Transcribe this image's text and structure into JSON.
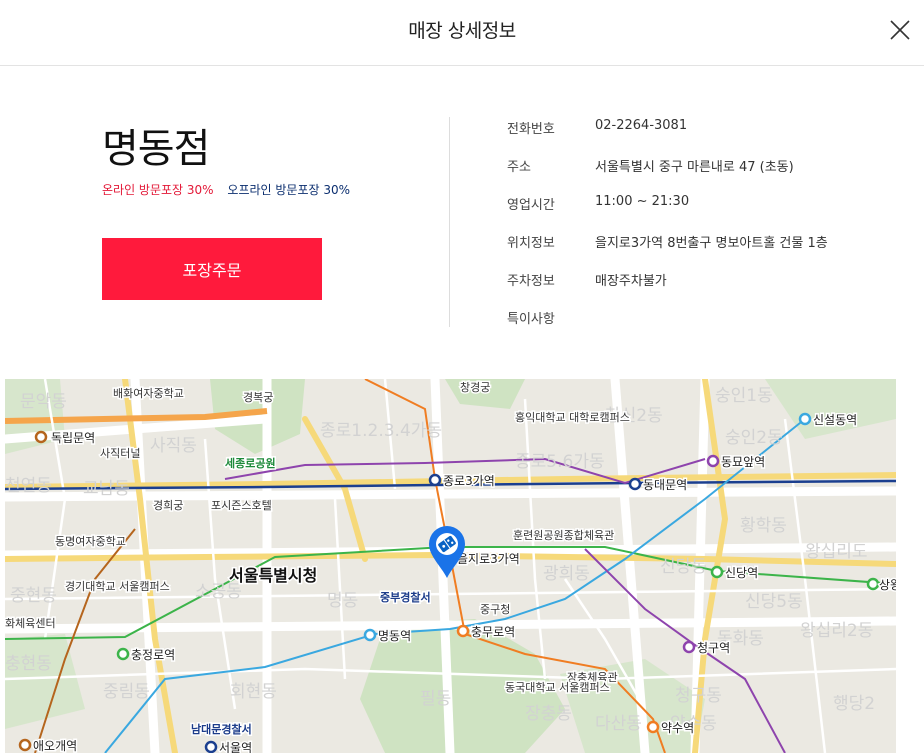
{
  "header": {
    "title": "매장 상세정보"
  },
  "store": {
    "name": "명동점",
    "promo_online": "온라인 방문포장 30%",
    "promo_offline": "오프라인 방문포장 30%",
    "order_button": "포장주문"
  },
  "info": [
    {
      "label": "전화번호",
      "value": "02-2264-3081"
    },
    {
      "label": "주소",
      "value": "서울특별시 중구 마른내로 47 (초동)"
    },
    {
      "label": "영업시간",
      "value": "11:00 ~ 21:30"
    },
    {
      "label": "위치정보",
      "value": "을지로3가역 8번출구 명보아트홀 건물 1층"
    },
    {
      "label": "주차정보",
      "value": "매장주차불가"
    },
    {
      "label": "특이사항",
      "value": ""
    }
  ],
  "map": {
    "district_labels": [
      "문악동",
      "사직동",
      "종로1.2.3.4가동",
      "창신2동",
      "숭인1동",
      "숭인2동",
      "종로5.6가동",
      "교남동",
      "천연동",
      "소공동",
      "명동",
      "광희동",
      "신당동",
      "신당5동",
      "황학동",
      "왕십리도",
      "왕십리2동",
      "중현동",
      "충현동",
      "회현동",
      "중림동",
      "필동",
      "장충동",
      "다산동",
      "청구동",
      "동화동",
      "약수동",
      "행당2"
    ],
    "stations": [
      "독립문역",
      "종로3가역",
      "신설동역",
      "동묘앞역",
      "동대문역",
      "을지로3가역",
      "신당역",
      "상왕",
      "충정로역",
      "명동역",
      "충무로역",
      "청구역",
      "약수역",
      "서울역",
      "애오개역"
    ],
    "pois": [
      "배화여자중학교",
      "경복궁",
      "창경궁",
      "홍익대학교 대학로캠퍼스",
      "사직터널",
      "세종로공원",
      "경희궁",
      "포시즌스호텔",
      "동명여자중학교",
      "훈련원공원종합체육관",
      "서울특별시청",
      "경기대학교 서울캠퍼스",
      "중부경찰서",
      "중구청",
      "화체육센터",
      "장충체육관",
      "동국대학교 서울캠퍼스",
      "남대문경찰서"
    ],
    "colors": {
      "line1": "#1b3f8f",
      "line2": "#3cb44a",
      "line3": "#f07d22",
      "line4": "#3aa8e0",
      "line5": "#8e44ad",
      "line6": "#b5651d",
      "marker": "#1a73e8"
    },
    "marker_icon": "domino-logo-icon"
  }
}
